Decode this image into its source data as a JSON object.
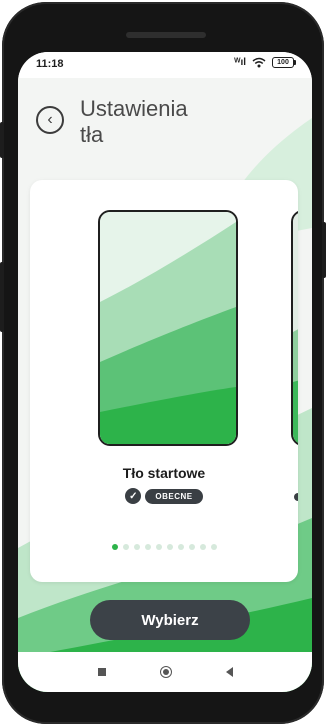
{
  "status_bar": {
    "time": "11:18",
    "signal_label": "ᵂıl",
    "battery_level": "100"
  },
  "header": {
    "title_line1": "Ustawienia",
    "title_line2": "tła",
    "back_icon": "chevron-left-circle-icon"
  },
  "carousel": {
    "selected_name": "Tło startowe",
    "badge": "OBECNE",
    "page_count": 10,
    "active_index": 0
  },
  "primary_button": {
    "label": "Wybierz"
  },
  "theme": {
    "accent": "#2db34a",
    "accent_light": "#6dcc86",
    "dark_button": "#3c4248"
  }
}
